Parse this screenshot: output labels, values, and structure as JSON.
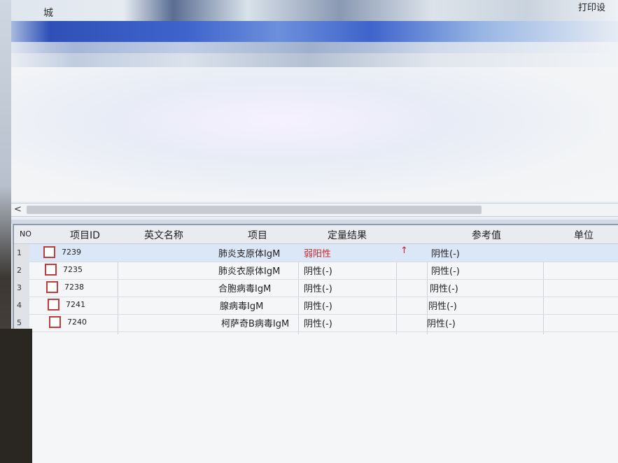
{
  "window": {
    "title": "城",
    "menu_label": "打印设"
  },
  "scrollbar": {
    "left_arrow": "<"
  },
  "grid": {
    "columns": {
      "no": "NO",
      "item_id": "项目ID",
      "english_name": "英文名称",
      "item": "项目",
      "quant_result": "定量结果",
      "reference": "参考值",
      "unit": "单位"
    },
    "rows": [
      {
        "no": "1",
        "item_id": "7239",
        "english_name": "",
        "item": "肺炎支原体IgM",
        "result": "弱阳性",
        "flag": "↑",
        "reference": "阴性(-)",
        "unit": "",
        "abnormal": true
      },
      {
        "no": "2",
        "item_id": "7235",
        "english_name": "",
        "item": "肺炎衣原体IgM",
        "result": "阴性(-)",
        "flag": "",
        "reference": "阴性(-)",
        "unit": "",
        "abnormal": false
      },
      {
        "no": "3",
        "item_id": "7238",
        "english_name": "",
        "item": "合胞病毒IgM",
        "result": "阴性(-)",
        "flag": "",
        "reference": "阴性(-)",
        "unit": "",
        "abnormal": false
      },
      {
        "no": "4",
        "item_id": "7241",
        "english_name": "",
        "item": "腺病毒IgM",
        "result": "阴性(-)",
        "flag": "",
        "reference": "阴性(-)",
        "unit": "",
        "abnormal": false
      },
      {
        "no": "5",
        "item_id": "7240",
        "english_name": "",
        "item": "柯萨奇B病毒IgM",
        "result": "阴性(-)",
        "flag": "",
        "reference": "阴性(-)",
        "unit": "",
        "abnormal": false
      }
    ]
  },
  "colors": {
    "abnormal": "#c8262a",
    "checkbox_border": "#c23a3a",
    "ribbon_blue": "#2b55c8"
  }
}
